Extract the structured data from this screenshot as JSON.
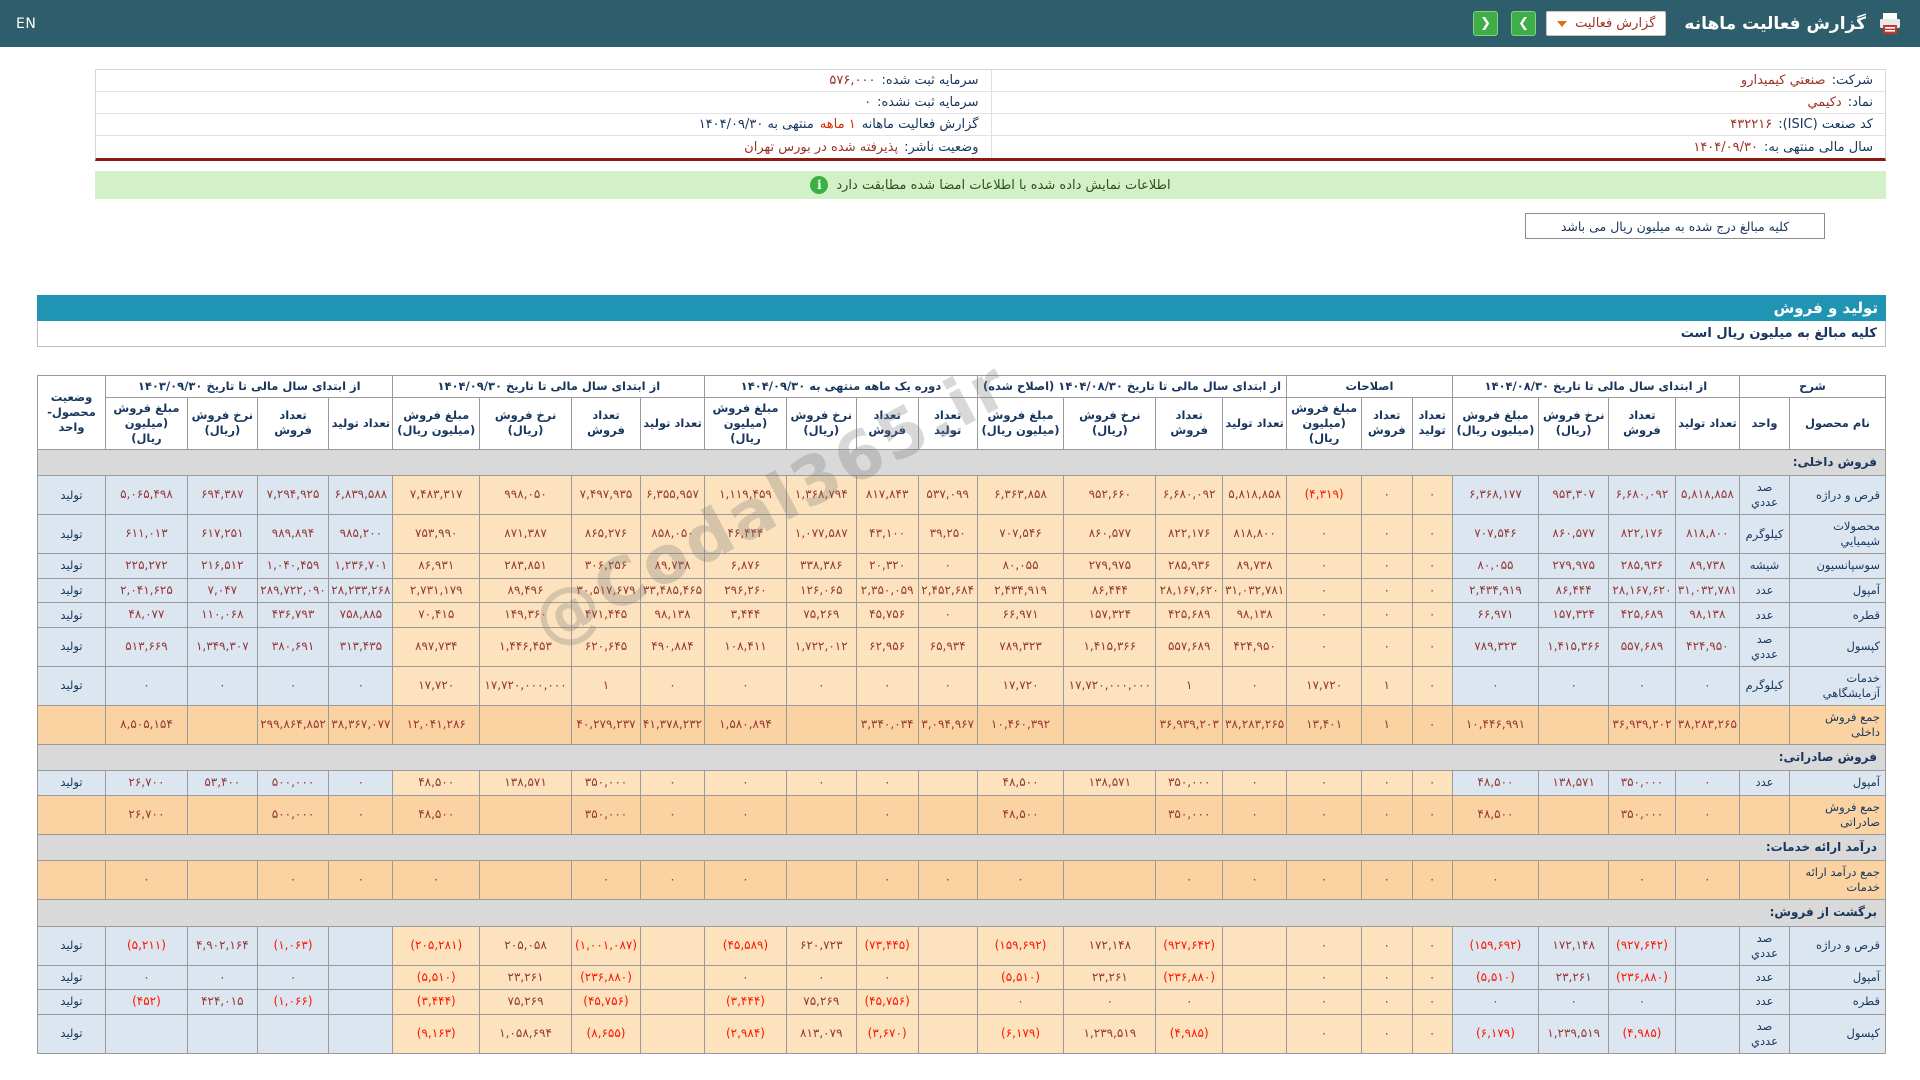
{
  "topbar": {
    "title": "گزارش فعالیت ماهانه",
    "dropdown_label": "گزارش فعالیت",
    "lang_toggle": "EN",
    "next_arrow": "❯",
    "prev_arrow": "❮"
  },
  "company_info": {
    "right": [
      {
        "label": "شرکت:",
        "value": "صنعتي کيميدارو"
      },
      {
        "label": "نماد:",
        "value": "دکيمي"
      },
      {
        "label": "کد صنعت (ISIC):",
        "value": "۴۳۲۲۱۶"
      },
      {
        "label": "سال مالی منتهی به:",
        "value": "۱۴۰۴/۰۹/۳۰"
      }
    ],
    "left": [
      {
        "label": "سرمایه ثبت شده:",
        "value": "۵۷۶,۰۰۰"
      },
      {
        "label": "سرمایه ثبت نشده:",
        "value": "۰"
      },
      {
        "label": "گزارش فعالیت ماهانه",
        "highlight": "۱ ماهه",
        "suffix": "منتهی به ۱۴۰۴/۰۹/۳۰"
      },
      {
        "label": "وضعیت ناشر:",
        "value": "پذیرفته شده در بورس تهران"
      }
    ]
  },
  "banner": {
    "text": "اطلاعات نمایش داده شده با اطلاعات امضا شده مطابقت دارد",
    "icon": "i"
  },
  "note": {
    "text": "کلیه مبالغ درج شده به میلیون ریال می باشد"
  },
  "section": {
    "title": "تولید و فروش",
    "subtitle": "کلیه مبالغ به میلیون ریال است"
  },
  "watermark": {
    "text": "@Codal365.ir"
  },
  "table": {
    "sharh_header": "شرح",
    "name_header": "نام محصول",
    "unit_header": "واحد",
    "status_header": "وضعیت محصول- واحد",
    "groups": [
      {
        "title": "از ابتدای سال مالی تا تاریخ ۱۴۰۴/۰۸/۳۰",
        "cols": [
          "تعداد تولید",
          "تعداد فروش",
          "نرخ فروش (ریال)",
          "مبلغ فروش (میلیون ریال)"
        ]
      },
      {
        "title": "اصلاحات",
        "cols": [
          "تعداد تولید",
          "تعداد فروش",
          "مبلغ فروش (میلیون ریال)"
        ]
      },
      {
        "title": "از ابتدای سال مالی تا تاریخ ۱۴۰۴/۰۸/۳۰ (اصلاح شده)",
        "cols": [
          "تعداد تولید",
          "تعداد فروش",
          "نرخ فروش (ریال)",
          "مبلغ فروش (میلیون ریال)"
        ]
      },
      {
        "title": "دوره یک ماهه منتهی به ۱۴۰۴/۰۹/۳۰",
        "cols": [
          "تعداد تولید",
          "تعداد فروش",
          "نرخ فروش (ریال)",
          "مبلغ فروش (میلیون ریال)"
        ]
      },
      {
        "title": "از ابتدای سال مالی تا تاریخ ۱۴۰۴/۰۹/۳۰",
        "cols": [
          "تعداد تولید",
          "تعداد فروش",
          "نرخ فروش (ریال)",
          "مبلغ فروش (میلیون ریال)"
        ]
      },
      {
        "title": "از ابتدای سال مالی تا تاریخ ۱۴۰۳/۰۹/۳۰",
        "cols": [
          "تعداد تولید",
          "تعداد فروش",
          "نرخ فروش (ریال)",
          "مبلغ فروش (میلیون ریال)"
        ]
      }
    ],
    "rows": [
      {
        "type": "section",
        "name": "فروش داخلی:"
      },
      {
        "type": "data",
        "name": "قرص و دراژه",
        "unit": "صد عددي",
        "status": "تولید",
        "cells": [
          "۵,۸۱۸,۸۵۸",
          "۶,۶۸۰,۰۹۲",
          "۹۵۳,۳۰۷",
          "۶,۳۶۸,۱۷۷",
          "۰",
          "۰",
          "(۴,۳۱۹)",
          "۵,۸۱۸,۸۵۸",
          "۶,۶۸۰,۰۹۲",
          "۹۵۲,۶۶۰",
          "۶,۳۶۳,۸۵۸",
          "۵۳۷,۰۹۹",
          "۸۱۷,۸۴۳",
          "۱,۳۶۸,۷۹۴",
          "۱,۱۱۹,۴۵۹",
          "۶,۳۵۵,۹۵۷",
          "۷,۴۹۷,۹۳۵",
          "۹۹۸,۰۵۰",
          "۷,۴۸۳,۳۱۷",
          "۶,۸۳۹,۵۸۸",
          "۷,۲۹۴,۹۲۵",
          "۶۹۴,۳۸۷",
          "۵,۰۶۵,۴۹۸"
        ]
      },
      {
        "type": "data",
        "name": "محصولات شيميايي",
        "unit": "کيلوگرم",
        "status": "تولید",
        "cells": [
          "۸۱۸,۸۰۰",
          "۸۲۲,۱۷۶",
          "۸۶۰,۵۷۷",
          "۷۰۷,۵۴۶",
          "۰",
          "۰",
          "۰",
          "۸۱۸,۸۰۰",
          "۸۲۲,۱۷۶",
          "۸۶۰,۵۷۷",
          "۷۰۷,۵۴۶",
          "۳۹,۲۵۰",
          "۴۳,۱۰۰",
          "۱,۰۷۷,۵۸۷",
          "۴۶,۴۴۴",
          "۸۵۸,۰۵۰",
          "۸۶۵,۲۷۶",
          "۸۷۱,۳۸۷",
          "۷۵۳,۹۹۰",
          "۹۸۵,۲۰۰",
          "۹۸۹,۸۹۴",
          "۶۱۷,۲۵۱",
          "۶۱۱,۰۱۳"
        ]
      },
      {
        "type": "data",
        "name": "سوسپانسيون",
        "unit": "شيشه",
        "status": "تولید",
        "cells": [
          "۸۹,۷۳۸",
          "۲۸۵,۹۳۶",
          "۲۷۹,۹۷۵",
          "۸۰,۰۵۵",
          "۰",
          "۰",
          "۰",
          "۸۹,۷۳۸",
          "۲۸۵,۹۳۶",
          "۲۷۹,۹۷۵",
          "۸۰,۰۵۵",
          "۰",
          "۲۰,۳۲۰",
          "۳۳۸,۳۸۶",
          "۶,۸۷۶",
          "۸۹,۷۳۸",
          "۳۰۶,۲۵۶",
          "۲۸۳,۸۵۱",
          "۸۶,۹۳۱",
          "۱,۲۳۶,۷۰۱",
          "۱,۰۴۰,۴۵۹",
          "۲۱۶,۵۱۲",
          "۲۲۵,۲۷۲"
        ]
      },
      {
        "type": "data",
        "name": "آمپول",
        "unit": "عدد",
        "status": "تولید",
        "cells": [
          "۳۱,۰۳۲,۷۸۱",
          "۲۸,۱۶۷,۶۲۰",
          "۸۶,۴۴۴",
          "۲,۴۳۴,۹۱۹",
          "۰",
          "۰",
          "۰",
          "۳۱,۰۳۲,۷۸۱",
          "۲۸,۱۶۷,۶۲۰",
          "۸۶,۴۴۴",
          "۲,۴۳۴,۹۱۹",
          "۲,۴۵۲,۶۸۴",
          "۲,۳۵۰,۰۵۹",
          "۱۲۶,۰۶۵",
          "۲۹۶,۲۶۰",
          "۳۳,۴۸۵,۴۶۵",
          "۳۰,۵۱۷,۶۷۹",
          "۸۹,۴۹۶",
          "۲,۷۳۱,۱۷۹",
          "۲۸,۲۳۳,۲۶۸",
          "۲۸۹,۷۲۲,۰۹۰",
          "۷,۰۴۷",
          "۲,۰۴۱,۶۲۵"
        ]
      },
      {
        "type": "data",
        "name": "قطره",
        "unit": "عدد",
        "status": "تولید",
        "cells": [
          "۹۸,۱۳۸",
          "۴۲۵,۶۸۹",
          "۱۵۷,۳۲۴",
          "۶۶,۹۷۱",
          "۰",
          "۰",
          "۰",
          "۹۸,۱۳۸",
          "۴۲۵,۶۸۹",
          "۱۵۷,۳۲۴",
          "۶۶,۹۷۱",
          "۰",
          "۴۵,۷۵۶",
          "۷۵,۲۶۹",
          "۳,۴۴۴",
          "۹۸,۱۳۸",
          "۴۷۱,۴۴۵",
          "۱۴۹,۳۶۰",
          "۷۰,۴۱۵",
          "۷۵۸,۸۸۵",
          "۴۳۶,۷۹۳",
          "۱۱۰,۰۶۸",
          "۴۸,۰۷۷"
        ]
      },
      {
        "type": "data",
        "name": "کپسول",
        "unit": "صد عددي",
        "status": "تولید",
        "cells": [
          "۴۲۴,۹۵۰",
          "۵۵۷,۶۸۹",
          "۱,۴۱۵,۳۶۶",
          "۷۸۹,۳۲۳",
          "۰",
          "۰",
          "۰",
          "۴۲۴,۹۵۰",
          "۵۵۷,۶۸۹",
          "۱,۴۱۵,۳۶۶",
          "۷۸۹,۳۲۳",
          "۶۵,۹۳۴",
          "۶۲,۹۵۶",
          "۱,۷۲۲,۰۱۲",
          "۱۰۸,۴۱۱",
          "۴۹۰,۸۸۴",
          "۶۲۰,۶۴۵",
          "۱,۴۴۶,۴۵۳",
          "۸۹۷,۷۳۴",
          "۳۱۳,۴۳۵",
          "۳۸۰,۶۹۱",
          "۱,۳۴۹,۳۰۷",
          "۵۱۳,۶۶۹"
        ]
      },
      {
        "type": "data",
        "name": "خدمات آزمايشگاهي",
        "unit": "کيلوگرم",
        "status": "تولید",
        "cells": [
          "۰",
          "۰",
          "۰",
          "۰",
          "۰",
          "۱",
          "۱۷,۷۲۰",
          "۰",
          "۱",
          "۱۷,۷۲۰,۰۰۰,۰۰۰",
          "۱۷,۷۲۰",
          "۰",
          "۰",
          "۰",
          "۰",
          "۰",
          "۱",
          "۱۷,۷۲۰,۰۰۰,۰۰۰",
          "۱۷,۷۲۰",
          "۰",
          "۰",
          "۰",
          "۰"
        ]
      },
      {
        "type": "total",
        "name": "جمع فروش داخلی",
        "unit": "",
        "status": "",
        "cells": [
          "۳۸,۲۸۳,۲۶۵",
          "۳۶,۹۳۹,۲۰۲",
          "",
          "۱۰,۴۴۶,۹۹۱",
          "۰",
          "۱",
          "۱۳,۴۰۱",
          "۳۸,۲۸۳,۲۶۵",
          "۳۶,۹۳۹,۲۰۳",
          "",
          "۱۰,۴۶۰,۳۹۲",
          "۳,۰۹۴,۹۶۷",
          "۳,۳۴۰,۰۳۴",
          "",
          "۱,۵۸۰,۸۹۴",
          "۴۱,۳۷۸,۲۳۲",
          "۴۰,۲۷۹,۲۳۷",
          "",
          "۱۲,۰۴۱,۲۸۶",
          "۳۸,۳۶۷,۰۷۷",
          "۲۹۹,۸۶۴,۸۵۲",
          "",
          "۸,۵۰۵,۱۵۴"
        ]
      },
      {
        "type": "section",
        "name": "فروش صادراتی:"
      },
      {
        "type": "data",
        "name": "آمپول",
        "unit": "عدد",
        "status": "تولید",
        "cells": [
          "۰",
          "۳۵۰,۰۰۰",
          "۱۳۸,۵۷۱",
          "۴۸,۵۰۰",
          "۰",
          "۰",
          "۰",
          "۰",
          "۳۵۰,۰۰۰",
          "۱۳۸,۵۷۱",
          "۴۸,۵۰۰",
          "",
          "۰",
          "۰",
          "۰",
          "۰",
          "۳۵۰,۰۰۰",
          "۱۳۸,۵۷۱",
          "۴۸,۵۰۰",
          "۰",
          "۵۰۰,۰۰۰",
          "۵۳,۴۰۰",
          "۲۶,۷۰۰"
        ]
      },
      {
        "type": "total",
        "name": "جمع فروش صادراتی",
        "unit": "",
        "status": "",
        "cells": [
          "۰",
          "۳۵۰,۰۰۰",
          "",
          "۴۸,۵۰۰",
          "۰",
          "۰",
          "۰",
          "۰",
          "۳۵۰,۰۰۰",
          "",
          "۴۸,۵۰۰",
          "",
          "۰",
          "",
          "۰",
          "۰",
          "۳۵۰,۰۰۰",
          "",
          "۴۸,۵۰۰",
          "۰",
          "۵۰۰,۰۰۰",
          "",
          "۲۶,۷۰۰"
        ]
      },
      {
        "type": "section",
        "name": "درآمد ارائه خدمات:"
      },
      {
        "type": "total",
        "name": "جمع درآمد ارائه خدمات",
        "unit": "",
        "status": "",
        "cells": [
          "۰",
          "۰",
          "",
          "۰",
          "۰",
          "۰",
          "۰",
          "۰",
          "۰",
          "",
          "۰",
          "۰",
          "۰",
          "",
          "۰",
          "۰",
          "۰",
          "",
          "۰",
          "۰",
          "۰",
          "",
          "۰"
        ]
      },
      {
        "type": "section",
        "name": "برگشت از فروش:"
      },
      {
        "type": "data",
        "name": "قرص و دراژه",
        "unit": "صد عددي",
        "status": "تولید",
        "cells": [
          "",
          "(۹۲۷,۶۴۲)",
          "۱۷۲,۱۴۸",
          "(۱۵۹,۶۹۲)",
          "۰",
          "۰",
          "۰",
          "",
          "(۹۲۷,۶۴۲)",
          "۱۷۲,۱۴۸",
          "(۱۵۹,۶۹۲)",
          "",
          "(۷۳,۴۴۵)",
          "۶۲۰,۷۲۳",
          "(۴۵,۵۸۹)",
          "",
          "(۱,۰۰۱,۰۸۷)",
          "۲۰۵,۰۵۸",
          "(۲۰۵,۲۸۱)",
          "",
          "(۱,۰۶۳)",
          "۴,۹۰۲,۱۶۴",
          "(۵,۲۱۱)"
        ]
      },
      {
        "type": "data",
        "name": "آمپول",
        "unit": "عدد",
        "status": "تولید",
        "cells": [
          "",
          "(۲۳۶,۸۸۰)",
          "۲۳,۲۶۱",
          "(۵,۵۱۰)",
          "۰",
          "۰",
          "۰",
          "",
          "(۲۳۶,۸۸۰)",
          "۲۳,۲۶۱",
          "(۵,۵۱۰)",
          "",
          "۰",
          "۰",
          "۰",
          "",
          "(۲۳۶,۸۸۰)",
          "۲۳,۲۶۱",
          "(۵,۵۱۰)",
          "",
          "۰",
          "۰",
          "۰"
        ]
      },
      {
        "type": "data",
        "name": "قطره",
        "unit": "عدد",
        "status": "تولید",
        "cells": [
          "",
          "۰",
          "۰",
          "۰",
          "۰",
          "۰",
          "۰",
          "",
          "۰",
          "۰",
          "۰",
          "",
          "(۴۵,۷۵۶)",
          "۷۵,۲۶۹",
          "(۳,۴۴۴)",
          "",
          "(۴۵,۷۵۶)",
          "۷۵,۲۶۹",
          "(۳,۴۴۴)",
          "",
          "(۱,۰۶۶)",
          "۴۲۴,۰۱۵",
          "(۴۵۲)"
        ]
      },
      {
        "type": "data",
        "name": "کپسول",
        "unit": "صد عددي",
        "status": "تولید",
        "cells": [
          "",
          "(۴,۹۸۵)",
          "۱,۲۳۹,۵۱۹",
          "(۶,۱۷۹)",
          "۰",
          "۰",
          "۰",
          "",
          "(۴,۹۸۵)",
          "۱,۲۳۹,۵۱۹",
          "(۶,۱۷۹)",
          "",
          "(۳,۶۷۰)",
          "۸۱۳,۰۷۹",
          "(۲,۹۸۴)",
          "",
          "(۸,۶۵۵)",
          "۱,۰۵۸,۶۹۴",
          "(۹,۱۶۳)",
          "",
          "",
          "",
          ""
        ]
      }
    ]
  }
}
